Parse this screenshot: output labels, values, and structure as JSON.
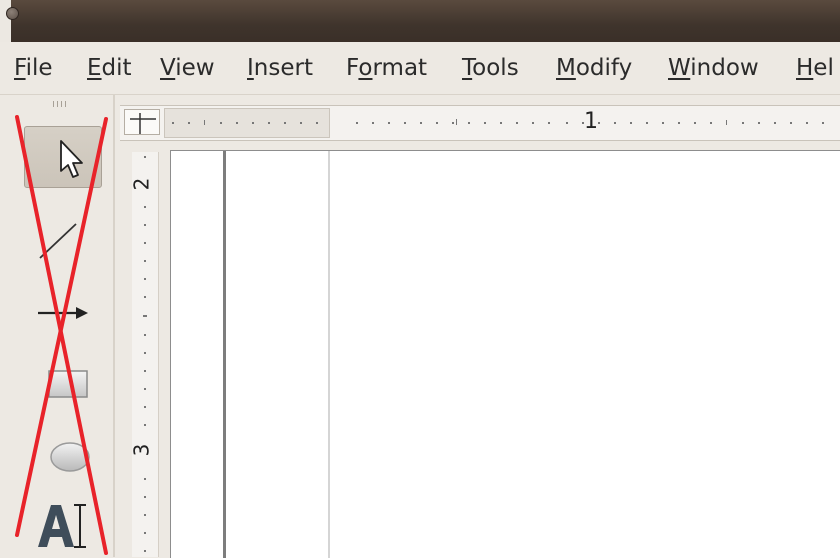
{
  "menubar": {
    "items": [
      {
        "before": "",
        "accel": "F",
        "after": "ile"
      },
      {
        "before": "",
        "accel": "E",
        "after": "dit"
      },
      {
        "before": "",
        "accel": "V",
        "after": "iew"
      },
      {
        "before": "",
        "accel": "I",
        "after": "nsert"
      },
      {
        "before": "F",
        "accel": "o",
        "after": "rmat"
      },
      {
        "before": "",
        "accel": "T",
        "after": "ools"
      },
      {
        "before": "",
        "accel": "M",
        "after": "odify"
      },
      {
        "before": "",
        "accel": "W",
        "after": "indow"
      },
      {
        "before": "",
        "accel": "H",
        "after": "el"
      }
    ]
  },
  "ruler": {
    "horizontal_number": "1",
    "vertical_numbers": [
      "2",
      "3"
    ]
  },
  "toolbar": {
    "tools": [
      "select-tool",
      "line-tool",
      "arrow-line-tool",
      "rectangle-tool",
      "ellipse-tool",
      "text-tool"
    ],
    "active_tool": "select-tool",
    "cross_color": "#e8232a"
  }
}
